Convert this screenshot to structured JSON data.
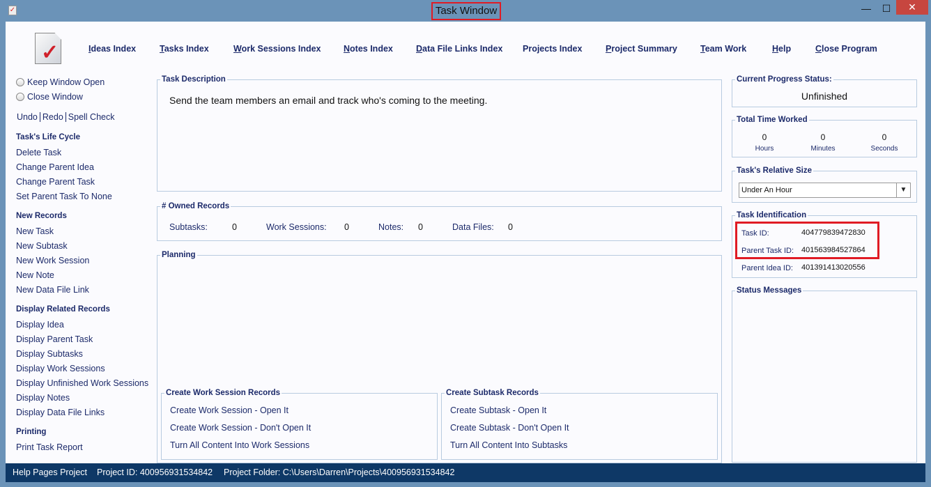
{
  "window": {
    "title": "Task Window",
    "minimize": "—",
    "maximize": "☐",
    "close": "✕"
  },
  "nav": [
    {
      "key": "I",
      "rest": "deas Index"
    },
    {
      "key": "T",
      "rest": "asks Index"
    },
    {
      "key": "W",
      "rest": "ork Sessions Index"
    },
    {
      "key": "N",
      "rest": "otes Index"
    },
    {
      "key": "D",
      "rest": "ata File Links Index"
    },
    {
      "key": "",
      "rest": "Projects Index"
    },
    {
      "key": "P",
      "rest": "roject Summary"
    },
    {
      "key": "T",
      "rest": "eam Work"
    },
    {
      "key": "H",
      "rest": "elp"
    },
    {
      "key": "C",
      "rest": "lose Program"
    }
  ],
  "sidebar": {
    "keep_open": "Keep Window Open",
    "close_window": "Close Window",
    "undo": "Undo",
    "redo": "Redo",
    "spell": "Spell Check",
    "sections": [
      {
        "title": "Task's Life Cycle",
        "items": [
          "Delete Task",
          "Change Parent Idea",
          "Change Parent Task",
          "Set Parent Task To None"
        ]
      },
      {
        "title": "New Records",
        "items": [
          "New Task",
          "New Subtask",
          "New Work Session",
          "New Note",
          "New Data File Link"
        ]
      },
      {
        "title": "Display Related Records",
        "items": [
          "Display Idea",
          "Display Parent Task",
          "Display Subtasks",
          "Display Work Sessions",
          "Display Unfinished Work Sessions",
          "Display Notes",
          "Display Data File Links"
        ]
      },
      {
        "title": "Printing",
        "items": [
          "Print Task Report"
        ]
      }
    ]
  },
  "main": {
    "desc_title": "Task Description",
    "desc": "Send the team members an email and track who's coming to the meeting.",
    "owned_title": "# Owned Records",
    "owned": [
      {
        "label": "Subtasks:",
        "value": "0"
      },
      {
        "label": "Work Sessions:",
        "value": "0"
      },
      {
        "label": "Notes:",
        "value": "0"
      },
      {
        "label": "Data Files:",
        "value": "0"
      }
    ],
    "planning_title": "Planning",
    "ws_title": "Create Work Session Records",
    "ws": [
      "Create Work Session - Open It",
      "Create Work Session - Don't Open It",
      "Turn All Content Into Work Sessions"
    ],
    "st_title": "Create Subtask Records",
    "st": [
      "Create Subtask - Open It",
      "Create Subtask - Don't Open It",
      "Turn All Content Into Subtasks"
    ]
  },
  "right": {
    "progress_title": "Current Progress Status:",
    "progress": "Unfinished",
    "time_title": "Total Time Worked",
    "time": [
      {
        "value": "0",
        "label": "Hours"
      },
      {
        "value": "0",
        "label": "Minutes"
      },
      {
        "value": "0",
        "label": "Seconds"
      }
    ],
    "size_title": "Task's Relative Size",
    "size": "Under An Hour",
    "id_title": "Task Identification",
    "task_id_label": "Task ID:",
    "task_id": "404779839472830",
    "parent_task_label": "Parent Task ID:",
    "parent_task": "401563984527864",
    "parent_idea_label": "Parent Idea ID:",
    "parent_idea": "401391413020556",
    "status_title": "Status Messages"
  },
  "status": {
    "project": "Help Pages Project",
    "project_id": "Project ID:  400956931534842",
    "folder": "Project Folder: C:\\Users\\Darren\\Projects\\400956931534842"
  },
  "colors": {
    "frame": "#6b93b8",
    "statusbar": "#0e3866",
    "highlight": "#e01b24"
  }
}
